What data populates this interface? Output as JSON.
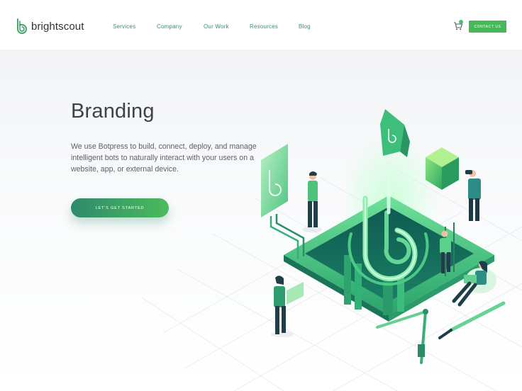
{
  "brand": {
    "name": "brightscout"
  },
  "nav": {
    "items": [
      {
        "label": "Services"
      },
      {
        "label": "Company"
      },
      {
        "label": "Our Work"
      },
      {
        "label": "Resources"
      },
      {
        "label": "Blog"
      }
    ],
    "cart_icon": "cart-icon",
    "contact_label": "CONTACT US"
  },
  "hero": {
    "title": "Branding",
    "description": "We use Botpress to build, connect, deploy, and manage intelligent bots to naturally interact with your users on a website, app, or external device.",
    "cta_label": "LET'S GET STARTED"
  },
  "colors": {
    "accent": "#46b85a",
    "nav_link": "#3b8f66",
    "title": "#3c4248",
    "body_text": "#5b6168",
    "cta_gradient_start": "#2e8a6c",
    "cta_gradient_end": "#4cbb5c"
  }
}
